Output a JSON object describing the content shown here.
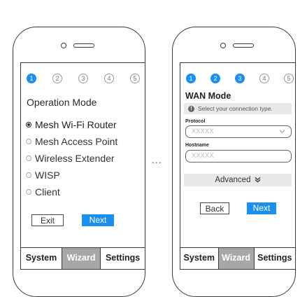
{
  "separator": "...",
  "left": {
    "steps": [
      "1",
      "2",
      "3",
      "4",
      "5"
    ],
    "active_steps": [
      1
    ],
    "title": "Operation Mode",
    "options": [
      {
        "label": "Mesh Wi-Fi Router",
        "selected": true
      },
      {
        "label": "Mesh Access Point",
        "selected": false
      },
      {
        "label": "Wireless Extender",
        "selected": false
      },
      {
        "label": "WISP",
        "selected": false
      },
      {
        "label": "Client",
        "selected": false
      }
    ],
    "exit_label": "Exit",
    "next_label": "Next",
    "tabs": [
      {
        "label": "System",
        "active": false
      },
      {
        "label": "Wizard",
        "active": true
      },
      {
        "label": "Settings",
        "active": false
      }
    ]
  },
  "right": {
    "steps": [
      "1",
      "2",
      "3",
      "4",
      "5"
    ],
    "active_steps": [
      1,
      2,
      3
    ],
    "title": "WAN Mode",
    "hint": "Select your connection type.",
    "protocol_label": "Protocol",
    "protocol_value": "XXXXX",
    "hostname_label": "Hostname",
    "hostname_value": "XXXXX",
    "advanced_label": "Advanced",
    "back_label": "Back",
    "next_label": "Next",
    "tabs": [
      {
        "label": "System",
        "active": false
      },
      {
        "label": "Wizard",
        "active": true
      },
      {
        "label": "Settings",
        "active": false
      }
    ]
  },
  "colors": {
    "accent": "#1b8ff0",
    "tab_active": "#a7a7a7",
    "hint_bg": "#e9e9e9"
  }
}
